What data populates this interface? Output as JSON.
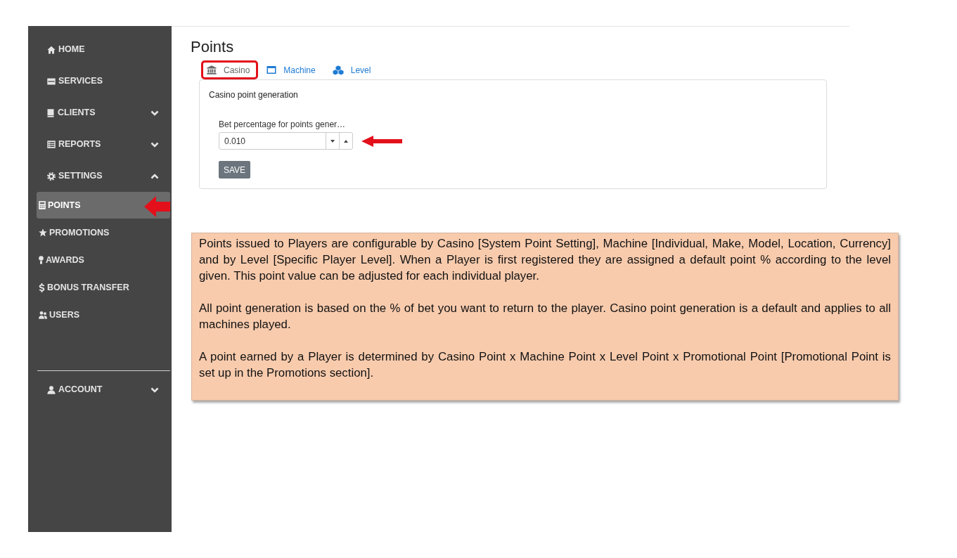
{
  "sidebar": {
    "items": [
      {
        "label": "HOME",
        "kind": "link",
        "selected": false
      },
      {
        "label": "SERVICES",
        "kind": "link",
        "selected": false
      },
      {
        "label": "CLIENTS",
        "kind": "menu",
        "selected": false,
        "expanded": false
      },
      {
        "label": "REPORTS",
        "kind": "menu",
        "selected": false,
        "expanded": false
      },
      {
        "label": "SETTINGS",
        "kind": "menu",
        "selected": false,
        "expanded": true,
        "children": [
          {
            "label": "POINTS",
            "selected": true
          },
          {
            "label": "PROMOTIONS",
            "selected": false
          },
          {
            "label": "AWARDS",
            "selected": false
          },
          {
            "label": "BONUS TRANSFER",
            "selected": false
          },
          {
            "label": "USERS",
            "selected": false
          }
        ]
      }
    ],
    "footer_items": [
      {
        "label": "ACCOUNT",
        "kind": "menu",
        "selected": false,
        "expanded": false
      }
    ]
  },
  "page": {
    "title": "Points",
    "tabs": [
      {
        "label": "Casino",
        "selected": true
      },
      {
        "label": "Machine",
        "selected": false
      },
      {
        "label": "Level",
        "selected": false
      }
    ],
    "panel": {
      "heading": "Casino point generation",
      "field": {
        "label": "Bet percentage for points gener…",
        "value": "0.010"
      },
      "buttons": [
        "SAVE"
      ]
    }
  },
  "note": {
    "paragraphs": [
      "Points issued to Players are configurable by Casino [System Point Setting], Machine [Individual, Make, Model, Location, Currency] and by Level [Specific Player Level]. When a Player is first registered they are assigned a default point % according to the level given. This point value can be adjusted for each individual player.",
      "All point generation is based on the % of bet you want to return to the player. Casino point generation is a default and applies to all machines played.",
      "A point earned by a Player is determined by Casino Point x Machine Point x Level Point x Promotional Point [Promotional Point is set up in the Promotions section]."
    ]
  }
}
